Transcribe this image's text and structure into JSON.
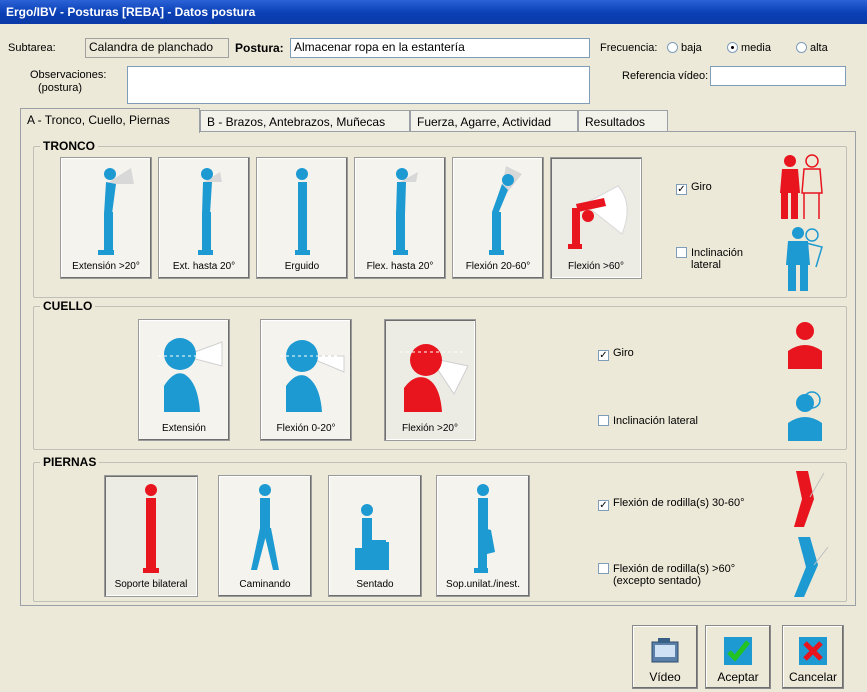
{
  "window": {
    "title": "Ergo/IBV - Posturas [REBA] - Datos postura"
  },
  "form": {
    "subtarea_label": "Subtarea:",
    "subtarea_value": "Calandra de planchado",
    "postura_label": "Postura:",
    "postura_value": "Almacenar ropa en la estantería",
    "frecuencia_label": "Frecuencia:",
    "frecuencia_options": [
      "baja",
      "media",
      "alta"
    ],
    "frecuencia_selected": "media",
    "observaciones_label_1": "Observaciones:",
    "observaciones_label_2": "(postura)",
    "observaciones_value": "",
    "referencia_label": "Referencia vídeo:",
    "referencia_value": ""
  },
  "tabs": [
    {
      "label": "A - Tronco, Cuello, Piernas",
      "active": true
    },
    {
      "label": "B - Brazos, Antebrazos, Muñecas",
      "active": false
    },
    {
      "label": "Fuerza, Agarre, Actividad",
      "active": false
    },
    {
      "label": "Resultados",
      "active": false
    }
  ],
  "tronco": {
    "title": "TRONCO",
    "postures": [
      {
        "label": "Extensión >20°",
        "selected": false
      },
      {
        "label": "Ext. hasta 20°",
        "selected": false
      },
      {
        "label": "Erguido",
        "selected": false
      },
      {
        "label": "Flex. hasta 20°",
        "selected": false
      },
      {
        "label": "Flexión 20-60°",
        "selected": false
      },
      {
        "label": "Flexión >60°",
        "selected": true
      }
    ],
    "giro_label": "Giro",
    "giro_checked": true,
    "inclinacion_label": "Inclinación\nlateral",
    "inclinacion_checked": false
  },
  "cuello": {
    "title": "CUELLO",
    "postures": [
      {
        "label": "Extensión",
        "selected": false
      },
      {
        "label": "Flexión 0-20°",
        "selected": false
      },
      {
        "label": "Flexión >20°",
        "selected": true
      }
    ],
    "giro_label": "Giro",
    "giro_checked": true,
    "inclinacion_label": "Inclinación lateral",
    "inclinacion_checked": false
  },
  "piernas": {
    "title": "PIERNAS",
    "postures": [
      {
        "label": "Soporte bilateral",
        "selected": true
      },
      {
        "label": "Caminando",
        "selected": false
      },
      {
        "label": "Sentado",
        "selected": false
      },
      {
        "label": "Sop.unilat./inest.",
        "selected": false
      }
    ],
    "flexion_3060_label": "Flexión de rodilla(s) 30-60°",
    "flexion_3060_checked": true,
    "flexion_60_label": "Flexión de rodilla(s) >60°\n(excepto sentado)",
    "flexion_60_checked": false
  },
  "buttons": {
    "video": "Vídeo",
    "aceptar": "Aceptar",
    "cancelar": "Cancelar"
  },
  "colors": {
    "accent_blue": "#1e9ad2",
    "selected_red": "#e8141e",
    "title_blue": "#0a3fb5"
  }
}
